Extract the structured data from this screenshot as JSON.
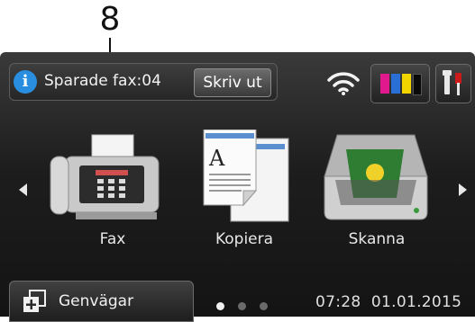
{
  "callout": {
    "number": "8"
  },
  "status": {
    "fax_text": "Sparade fax:04",
    "print_label": "Skriv ut",
    "info_icon": "i"
  },
  "apps": [
    {
      "label": "Fax"
    },
    {
      "label": "Kopiera"
    },
    {
      "label": "Skanna"
    }
  ],
  "ink_colors": [
    "#e01a8c",
    "#2a6fd6",
    "#f2d500",
    "#111111"
  ],
  "footer": {
    "shortcut_label": "Genvägar",
    "time": "07:28",
    "date": "01.01.2015",
    "page_dots": 3,
    "active_dot": 1
  }
}
